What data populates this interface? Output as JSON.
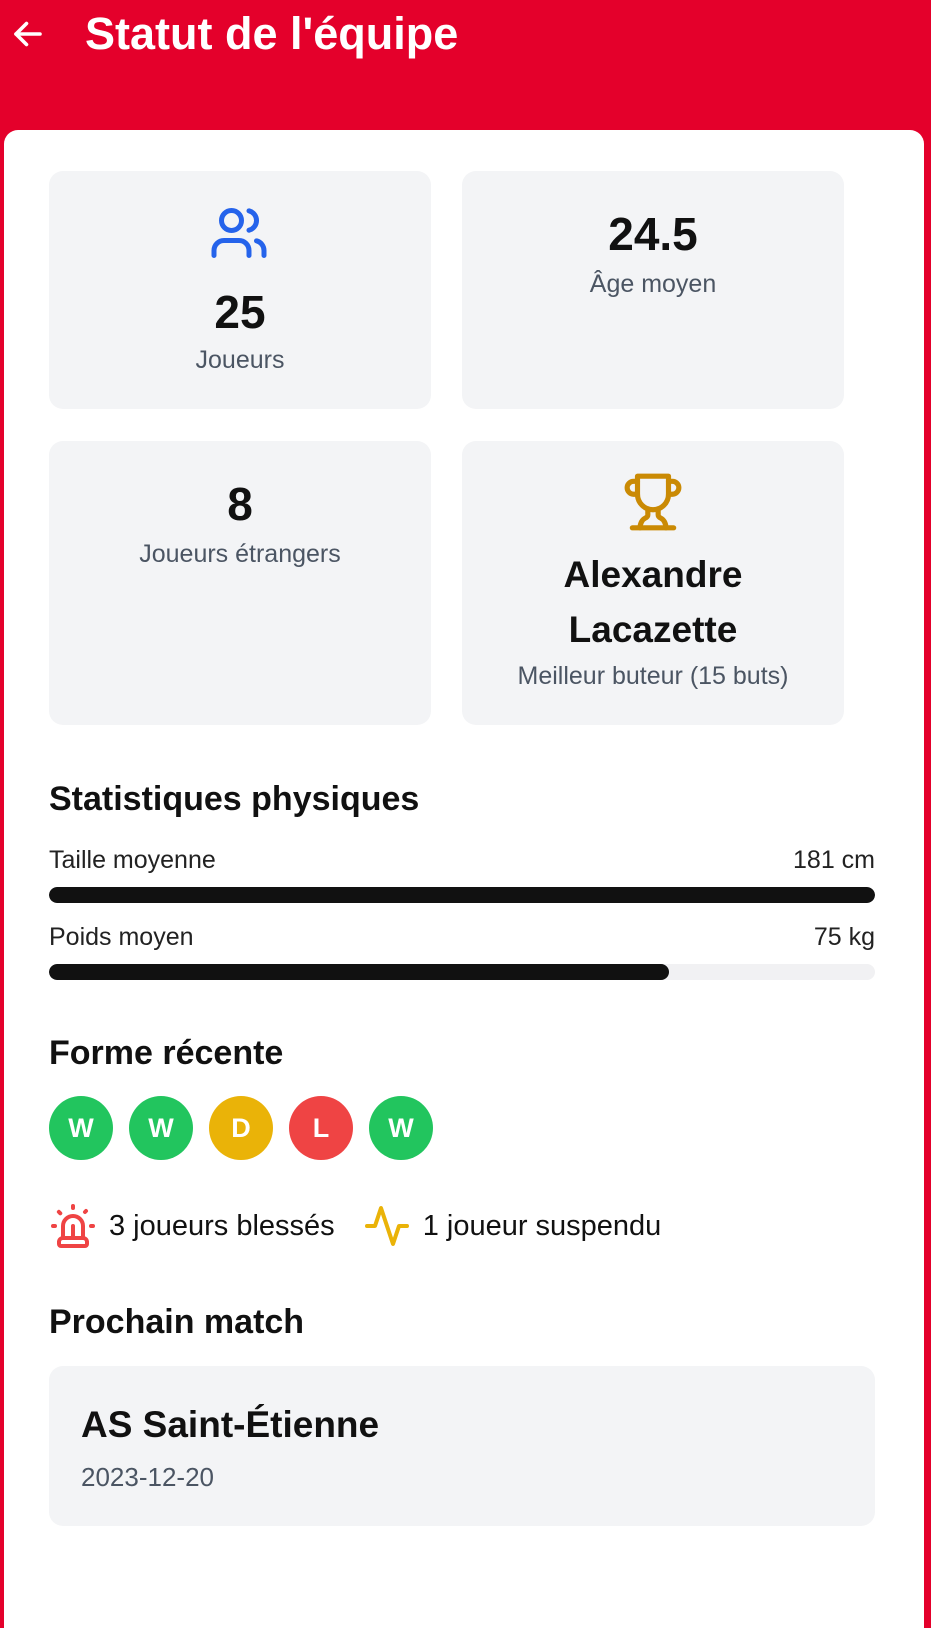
{
  "header": {
    "title": "Statut de l'équipe",
    "back_icon": "arrow-left-icon"
  },
  "stats": {
    "players": {
      "value": "25",
      "label": "Joueurs",
      "icon": "users-icon",
      "icon_color": "#2563eb"
    },
    "avg_age": {
      "value": "24.5",
      "label": "Âge moyen"
    },
    "foreign_players": {
      "value": "8",
      "label": "Joueurs étrangers"
    },
    "top_scorer": {
      "name_line1": "Alexandre",
      "name_line2": "Lacazette",
      "label": "Meilleur buteur (15 buts)",
      "icon": "trophy-icon",
      "icon_color": "#ca8a04"
    }
  },
  "physical": {
    "title": "Statistiques physiques",
    "rows": [
      {
        "label": "Taille moyenne",
        "value": "181 cm",
        "fill": 1.0
      },
      {
        "label": "Poids moyen",
        "value": "75 kg",
        "fill": 0.75
      }
    ]
  },
  "form": {
    "title": "Forme récente",
    "results": [
      {
        "letter": "W",
        "color": "#22c55e"
      },
      {
        "letter": "W",
        "color": "#22c55e"
      },
      {
        "letter": "D",
        "color": "#eab308"
      },
      {
        "letter": "L",
        "color": "#ef4444"
      },
      {
        "letter": "W",
        "color": "#22c55e"
      }
    ]
  },
  "availability": {
    "injured": {
      "text": "3 joueurs blessés",
      "icon": "siren-icon",
      "color": "#ef4444"
    },
    "suspended": {
      "text": "1 joueur suspendu",
      "icon": "activity-icon",
      "color": "#eab308"
    }
  },
  "next_match": {
    "title": "Prochain match",
    "opponent": "AS Saint-Étienne",
    "date": "2023-12-20"
  },
  "colors": {
    "brand": "#e4002b",
    "tile_bg": "#f3f4f6"
  }
}
